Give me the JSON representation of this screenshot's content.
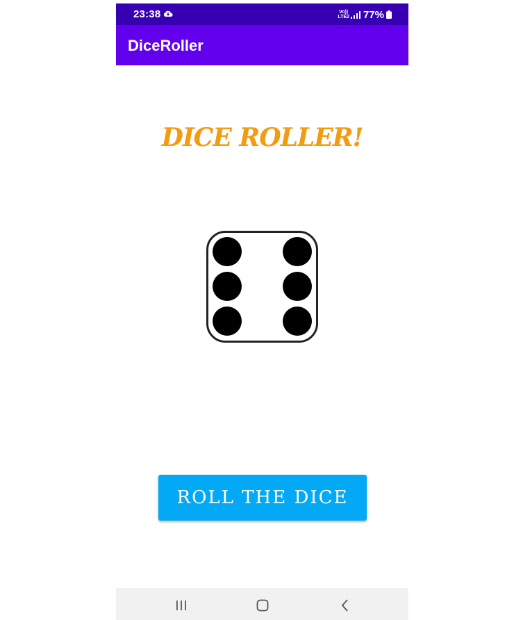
{
  "status_bar": {
    "time": "23:38",
    "network_label_top": "Vo))",
    "network_label_bottom": "LTE2",
    "battery_percent": "77%",
    "icons": [
      "cloud-icon",
      "signal-icon",
      "battery-icon"
    ]
  },
  "app_bar": {
    "title": "DiceRoller"
  },
  "main": {
    "heading": "DICE ROLLER!",
    "dice_face": 6,
    "dice_icon": "dice-six-icon",
    "button_label": "ROLL THE DICE"
  },
  "nav_bar": {
    "icons": [
      "recent-apps-icon",
      "home-icon",
      "back-icon"
    ]
  },
  "colors": {
    "status_bar": "#3700b3",
    "app_bar": "#6200ee",
    "heading": "#f39c12",
    "button": "#03a9f4",
    "nav_bar": "#f1f1f1"
  }
}
